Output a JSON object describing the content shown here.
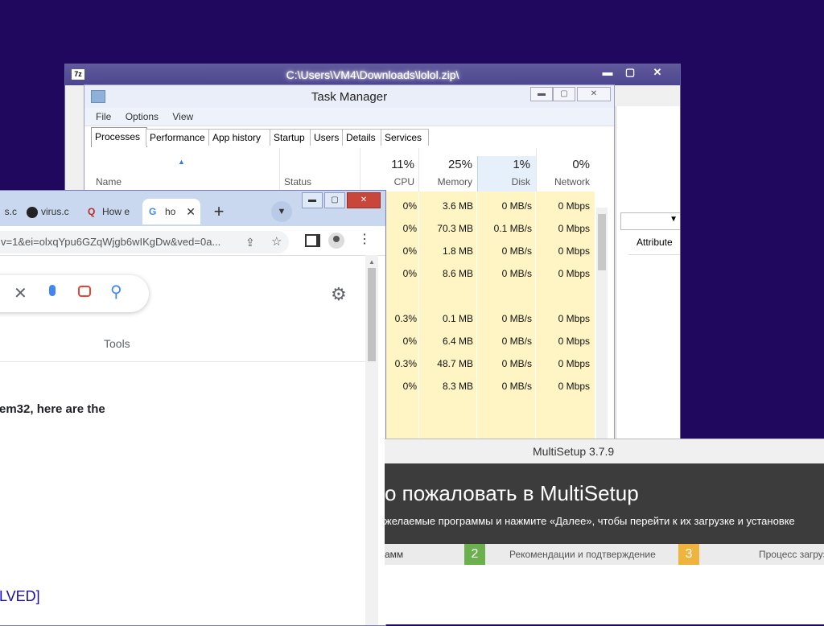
{
  "zip": {
    "title": "C:\\Users\\VM4\\Downloads\\lolol.zip\\",
    "icon": "7z",
    "min": "▬",
    "max": "▢",
    "close": "✕",
    "attributes_header": "Attribute"
  },
  "taskmanager": {
    "title": "Task Manager",
    "menu": [
      "File",
      "Options",
      "View"
    ],
    "tabs": [
      "Processes",
      "Performance",
      "App history",
      "Startup",
      "Users",
      "Details",
      "Services"
    ],
    "columns": {
      "name": "Name",
      "status": "Status",
      "cpu_pct": "11%",
      "cpu": "CPU",
      "mem_pct": "25%",
      "mem": "Memory",
      "disk_pct": "1%",
      "disk": "Disk",
      "net_pct": "0%",
      "net": "Network"
    },
    "rows": [
      {
        "cpu": "0%",
        "mem": "3.6 MB",
        "disk": "0 MB/s",
        "net": "0 Mbps"
      },
      {
        "cpu": "0%",
        "mem": "70.3 MB",
        "disk": "0.1 MB/s",
        "net": "0 Mbps"
      },
      {
        "cpu": "0%",
        "mem": "1.8 MB",
        "disk": "0 MB/s",
        "net": "0 Mbps"
      },
      {
        "cpu": "0%",
        "mem": "8.6 MB",
        "disk": "0 MB/s",
        "net": "0 Mbps"
      },
      {
        "cpu": "",
        "mem": "",
        "disk": "",
        "net": ""
      },
      {
        "cpu": "0.3%",
        "mem": "0.1 MB",
        "disk": "0 MB/s",
        "net": "0 Mbps"
      },
      {
        "cpu": "0%",
        "mem": "6.4 MB",
        "disk": "0 MB/s",
        "net": "0 Mbps"
      },
      {
        "cpu": "0.3%",
        "mem": "48.7 MB",
        "disk": "0 MB/s",
        "net": "0 Mbps"
      },
      {
        "cpu": "0%",
        "mem": "8.3 MB",
        "disk": "0 MB/s",
        "net": "0 Mbps"
      }
    ]
  },
  "chrome": {
    "tabs": [
      {
        "label": "s.c",
        "icon": "blank-icon"
      },
      {
        "label": "virus.c",
        "icon": "github-icon"
      },
      {
        "label": "How e",
        "icon": "quora-icon"
      },
      {
        "label": "ho",
        "icon": "google-icon"
      }
    ],
    "url": "v=1&ei=olxqYpu6GZqWjgb6wIKgDw&ved=0a...",
    "tools": "Tools",
    "snippet": "em32, here are the",
    "result": "LVED]"
  },
  "multisetup": {
    "title": "MultiSetup 3.7.9",
    "welcome": "о пожаловать в MultiSetup",
    "subtitle": "желаемые программы и нажмите «Далее», чтобы перейти к их загрузке и установке",
    "step1": "амм",
    "step2_num": "2",
    "step2": "Рекомендации и подтверждение",
    "step3_num": "3",
    "step3": "Процесс загруз"
  },
  "colors": {
    "desktop": "#20085e",
    "step2": "#6ab04c",
    "step3": "#f0b43c"
  }
}
